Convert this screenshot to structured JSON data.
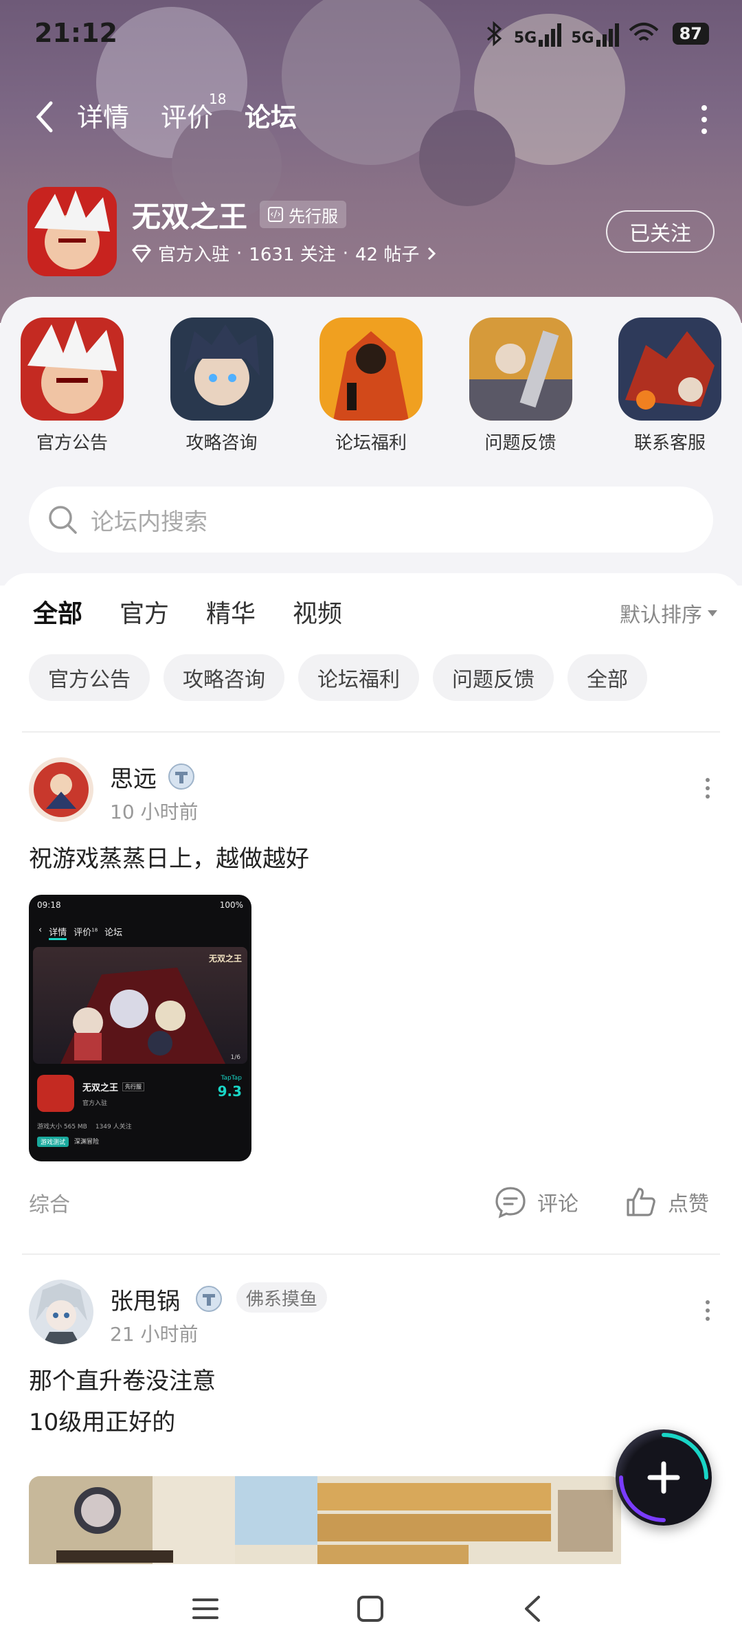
{
  "status_bar": {
    "time": "21:12",
    "battery": "87",
    "net1": "5G",
    "net2": "5G"
  },
  "nav": {
    "tabs": [
      {
        "label": "详情"
      },
      {
        "label": "评价",
        "badge": "18"
      },
      {
        "label": "论坛",
        "active": true
      }
    ]
  },
  "game": {
    "title": "无双之王",
    "badge": "先行服",
    "official": "官方入驻",
    "followers": "1631 关注",
    "posts": "42 帖子",
    "follow_button": "已关注"
  },
  "categories": [
    {
      "label": "官方公告"
    },
    {
      "label": "攻略咨询"
    },
    {
      "label": "论坛福利"
    },
    {
      "label": "问题反馈"
    },
    {
      "label": "联系客服"
    }
  ],
  "search": {
    "placeholder": "论坛内搜索"
  },
  "feed_tabs": [
    {
      "label": "全部",
      "active": true
    },
    {
      "label": "官方"
    },
    {
      "label": "精华"
    },
    {
      "label": "视频"
    }
  ],
  "sort": {
    "label": "默认排序"
  },
  "chips": [
    {
      "label": "官方公告"
    },
    {
      "label": "攻略咨询"
    },
    {
      "label": "论坛福利"
    },
    {
      "label": "问题反馈"
    },
    {
      "label": "全部"
    }
  ],
  "posts": [
    {
      "author": "思远",
      "time": "10 小时前",
      "text": "祝游戏蒸蒸日上，越做越好",
      "category": "综合",
      "comment_label": "评论",
      "like_label": "点赞",
      "image": {
        "status_time": "09:18",
        "status_battery": "100%",
        "tabs": [
          "详情",
          "评价",
          "论坛"
        ],
        "tab_badge": "18",
        "banner_title": "无双之王",
        "page_counter": "1/6",
        "game_title": "无双之王",
        "game_badge": "先行服",
        "official": "官方入驻",
        "rating_brand": "TapTap",
        "rating": "9.3",
        "size": "游戏大小 565 MB",
        "followers": "1349 人关注",
        "tag1": "游戏测试",
        "tag2": "深渊冒险"
      }
    },
    {
      "author": "张甩锅",
      "tag": "佛系摸鱼",
      "time": "21 小时前",
      "text": "那个直升卷没注意\n10级用正好的"
    }
  ],
  "colors": {
    "accent": "#19d5c6",
    "header_bg": "#7d6885",
    "panel_bg": "#f4f4f7"
  }
}
